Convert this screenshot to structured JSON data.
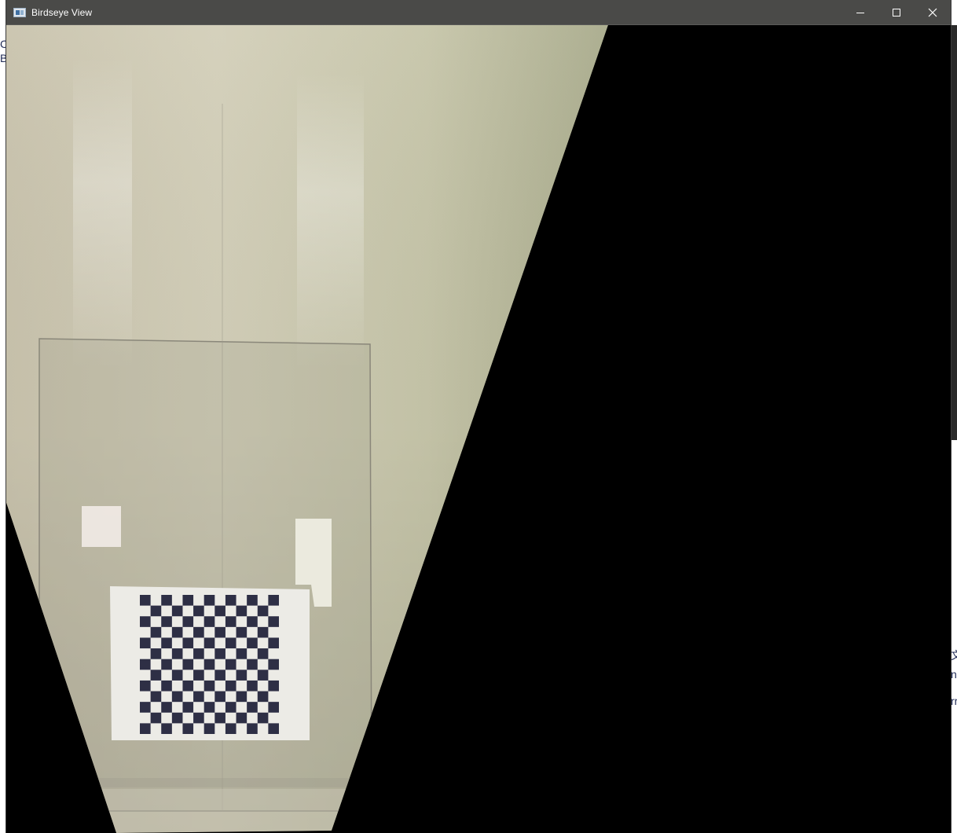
{
  "window": {
    "title": "Birdseye View",
    "icon": "app-window-icon",
    "controls": {
      "minimize": "minimize-icon",
      "maximize": "maximize-icon",
      "close": "close-icon"
    }
  },
  "background_fragments": {
    "left_top": "Ca",
    "left_second": "Bi",
    "right_1": "文",
    "right_2": "n",
    "right_3": "rr"
  },
  "content": {
    "description_visible_image": "birdseye-warped-camera-frame",
    "chessboard": {
      "rows": 13,
      "cols": 13
    }
  },
  "colors": {
    "titlebar": "#4a4a48",
    "floor": "#c9c6b2",
    "void": "#000000",
    "checker_dark": "#2e2f45"
  }
}
